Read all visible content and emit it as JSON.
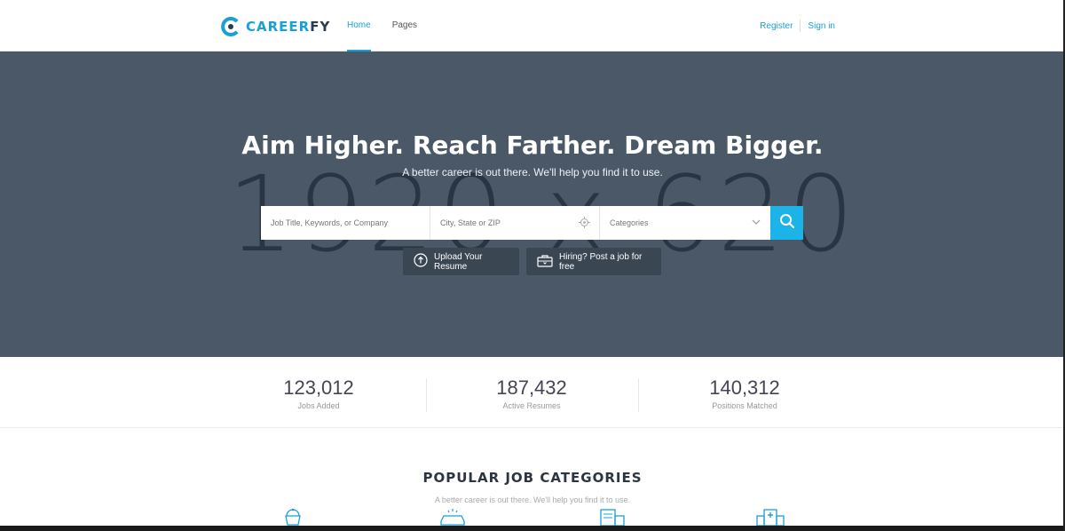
{
  "brand": {
    "name_part1": "CAREER",
    "name_part2": "FY"
  },
  "nav": {
    "items": [
      {
        "label": "Home"
      },
      {
        "label": "Pages"
      }
    ]
  },
  "auth": {
    "register": "Register",
    "signin": "Sign in"
  },
  "hero": {
    "placeholder_text": "1920 x 620",
    "title": "Aim Higher. Reach Farther. Dream Bigger.",
    "subtitle": "A better career is out there. We'll help you find it to use."
  },
  "search": {
    "keyword_placeholder": "Job Title, Keywords, or Company",
    "location_placeholder": "City, State or ZIP",
    "category_value": "Categories"
  },
  "cta": {
    "upload_label": "Upload Your Resume",
    "post_label": "Hiring? Post a job for free"
  },
  "stats": [
    {
      "value": "123,012",
      "label": "Jobs Added"
    },
    {
      "value": "187,432",
      "label": "Active Resumes"
    },
    {
      "value": "140,312",
      "label": "Positions Matched"
    }
  ],
  "categories": {
    "title": "POPULAR JOB CATEGORIES",
    "subtitle": "A better career is out there. We'll help you find it to use.",
    "icons": [
      "cupcake-icon",
      "car-wash-icon",
      "accounting-icon",
      "hospital-icon"
    ]
  },
  "colors": {
    "accent": "#1b9fd9",
    "search_button": "#1bb3e8",
    "hero_bg": "#4a5868"
  }
}
